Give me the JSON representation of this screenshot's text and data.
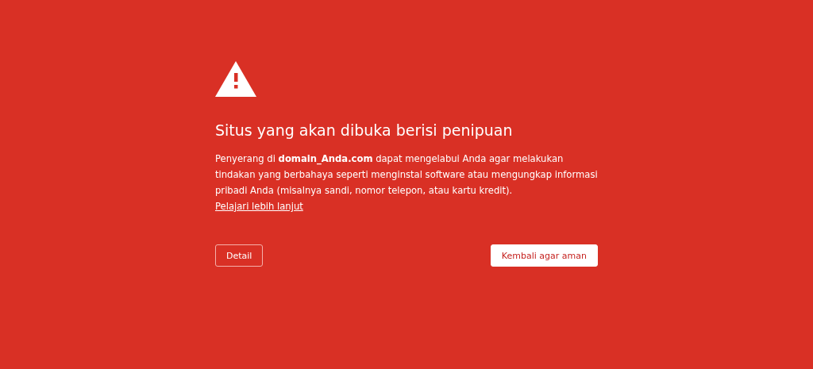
{
  "title": "Situs yang akan dibuka berisi penipuan",
  "message": {
    "text": "Penyerang di **domain_Anda.com** dapat mengelabui Anda agar melakukan tindakan yang berbahaya seperti menginstal software atau mengungkap informasi pribadi Anda (misalnya sandi, nomor telepon, atau kartu kredit).",
    "link": "Pelajari lebih lanjut"
  },
  "buttons": [
    {
      "label": "Detail",
      "kind": "outline"
    },
    {
      "label": "Kembali agar aman",
      "kind": "primary"
    }
  ]
}
